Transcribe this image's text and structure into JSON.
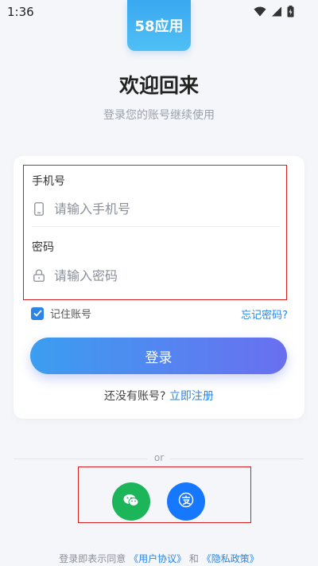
{
  "status_bar": {
    "time": "1:36"
  },
  "app": {
    "logo_text": "58应用",
    "accent_color": "#2a86e6"
  },
  "header": {
    "title": "欢迎回来",
    "subtitle": "登录您的账号继续使用"
  },
  "form": {
    "phone": {
      "label": "手机号",
      "placeholder": "请输入手机号",
      "value": ""
    },
    "password": {
      "label": "密码",
      "placeholder": "请输入密码",
      "value": ""
    },
    "remember_label": "记住账号",
    "remember_checked": true,
    "forgot_label": "忘记密码?",
    "login_label": "登录",
    "register_prompt": "还没有账号?",
    "register_link": "立即注册"
  },
  "social": {
    "divider_text": "or",
    "buttons": [
      {
        "name": "wechat",
        "icon": "wechat-icon",
        "color": "#1db55a"
      },
      {
        "name": "alipay",
        "icon": "alipay-icon",
        "color": "#1677ff"
      }
    ]
  },
  "footer": {
    "agreement_prefix": "登录即表示同意",
    "user_agreement": "《用户协议》",
    "and": "和",
    "privacy_policy": "《隐私政策》"
  }
}
